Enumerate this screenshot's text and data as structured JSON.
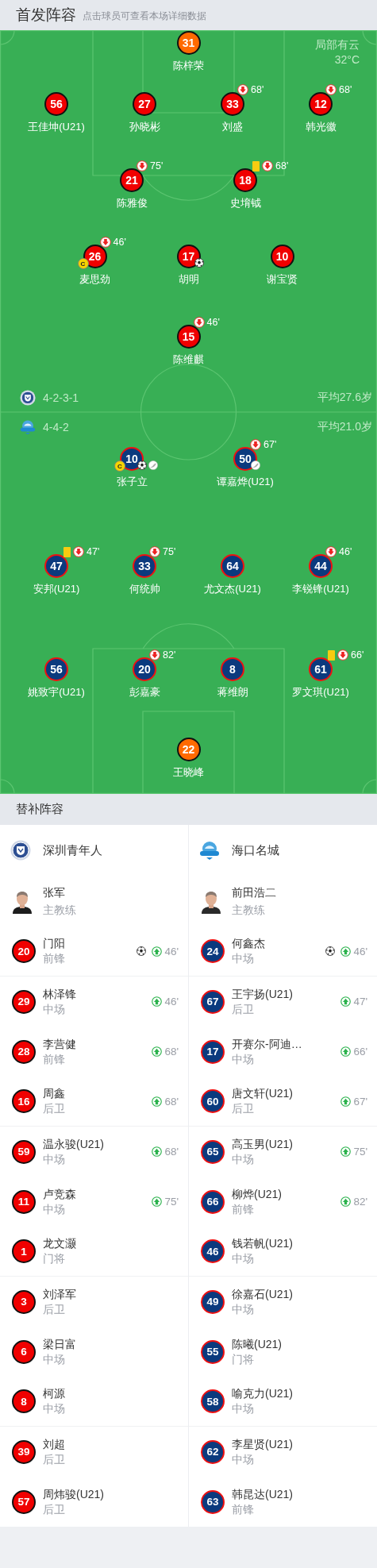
{
  "header": {
    "title": "首发阵容",
    "hint": "点击球员可查看本场详细数据"
  },
  "pitch": {
    "weather": "局部有云",
    "temperature": "32°C",
    "home": {
      "kind": "home",
      "formation": "4-2-3-1",
      "average_age": "平均27.6岁",
      "rows": [
        {
          "players": [
            {
              "number": "31",
              "name": "陈梓荣",
              "kind": "goalkeeper",
              "yellow_card": false,
              "goal": false,
              "assist": false
            }
          ]
        },
        {
          "players": [
            {
              "number": "56",
              "name": "王佳坤(U21)",
              "kind": "outfield",
              "yellow_card": false,
              "goal": false,
              "assist": false
            },
            {
              "number": "27",
              "name": "孙晓彬",
              "kind": "outfield",
              "yellow_card": false,
              "goal": false,
              "assist": false
            },
            {
              "number": "33",
              "name": "刘盛",
              "kind": "outfield",
              "yellow_card": false,
              "goal": false,
              "assist": false,
              "sub_out": "68'"
            },
            {
              "number": "12",
              "name": "韩光徽",
              "kind": "outfield",
              "yellow_card": false,
              "goal": false,
              "assist": false,
              "sub_out": "68'"
            }
          ]
        },
        {
          "players": [
            {
              "number": "21",
              "name": "陈雅俊",
              "kind": "outfield",
              "yellow_card": false,
              "goal": false,
              "assist": false,
              "sub_out": "75'"
            },
            {
              "number": "18",
              "name": "史堉钺",
              "kind": "outfield",
              "yellow_card": true,
              "goal": false,
              "assist": false,
              "sub_out": "68'"
            }
          ]
        },
        {
          "players": [
            {
              "number": "26",
              "name": "麦思劲",
              "kind": "outfield",
              "yellow_card": false,
              "goal": false,
              "assist": false,
              "sub_out": "46'",
              "captain_mark": "C"
            },
            {
              "number": "17",
              "name": "胡明",
              "kind": "outfield",
              "yellow_card": false,
              "goal": true,
              "assist": false
            },
            {
              "number": "10",
              "name": "谢宝贤",
              "kind": "outfield",
              "yellow_card": false,
              "goal": false,
              "assist": false
            }
          ]
        },
        {
          "players": [
            {
              "number": "15",
              "name": "陈维麒",
              "kind": "outfield",
              "yellow_card": false,
              "goal": false,
              "assist": false,
              "sub_out": "46'"
            }
          ]
        }
      ]
    },
    "away": {
      "kind": "away",
      "formation": "4-4-2",
      "average_age": "平均21.0岁",
      "rows": [
        {
          "players": [
            {
              "number": "10",
              "name": "张子立",
              "kind": "outfield",
              "yellow_card": false,
              "goal": true,
              "assist": true,
              "captain_mark": "C"
            },
            {
              "number": "50",
              "name": "谭嘉烨(U21)",
              "kind": "outfield",
              "yellow_card": false,
              "goal": false,
              "assist": true,
              "sub_out": "67'"
            }
          ]
        },
        {
          "players": [
            {
              "number": "47",
              "name": "安邦(U21)",
              "kind": "outfield",
              "yellow_card": true,
              "goal": false,
              "assist": false,
              "sub_out": "47'"
            },
            {
              "number": "33",
              "name": "何统帅",
              "kind": "outfield",
              "yellow_card": false,
              "goal": false,
              "assist": false,
              "sub_out": "75'"
            },
            {
              "number": "64",
              "name": "尤文杰(U21)",
              "kind": "outfield",
              "yellow_card": false,
              "goal": false,
              "assist": false
            },
            {
              "number": "44",
              "name": "李锐锋(U21)",
              "kind": "outfield",
              "yellow_card": false,
              "goal": false,
              "assist": false,
              "sub_out": "46'"
            }
          ]
        },
        {
          "players": [
            {
              "number": "56",
              "name": "姚致宇(U21)",
              "kind": "outfield",
              "yellow_card": false,
              "goal": false,
              "assist": false
            },
            {
              "number": "20",
              "name": "彭嘉豪",
              "kind": "outfield",
              "yellow_card": false,
              "goal": false,
              "assist": false,
              "sub_out": "82'"
            },
            {
              "number": "8",
              "name": "蒋维朗",
              "kind": "outfield",
              "yellow_card": false,
              "goal": false,
              "assist": false
            },
            {
              "number": "61",
              "name": "罗文琪(U21)",
              "kind": "outfield",
              "yellow_card": true,
              "goal": false,
              "assist": false,
              "sub_out": "66'"
            }
          ]
        },
        {
          "players": [
            {
              "number": "22",
              "name": "王晓峰",
              "kind": "goalkeeper",
              "yellow_card": false,
              "goal": false,
              "assist": false
            }
          ]
        }
      ]
    }
  },
  "substitutes": {
    "title": "替补阵容",
    "teams": [
      {
        "kind": "home",
        "name": "深圳青年人",
        "coach": {
          "name": "张军",
          "role": "主教练"
        },
        "players": [
          {
            "number": "20",
            "name": "门阳",
            "position": "前锋",
            "goal": true,
            "sub_in": "46'"
          },
          {
            "number": "29",
            "name": "林泽锋",
            "position": "中场",
            "goal": false,
            "sub_in": "46'"
          },
          {
            "number": "28",
            "name": "李营健",
            "position": "前锋",
            "goal": false,
            "sub_in": "68'"
          },
          {
            "number": "16",
            "name": "周鑫",
            "position": "后卫",
            "goal": false,
            "sub_in": "68'"
          },
          {
            "number": "59",
            "name": "温永骏(U21)",
            "position": "中场",
            "goal": false,
            "sub_in": "68'"
          },
          {
            "number": "11",
            "name": "卢竞森",
            "position": "中场",
            "goal": false,
            "sub_in": "75'"
          },
          {
            "number": "1",
            "name": "龙文灏",
            "position": "门将",
            "goal": false
          },
          {
            "number": "3",
            "name": "刘泽军",
            "position": "后卫",
            "goal": false
          },
          {
            "number": "6",
            "name": "梁日富",
            "position": "中场",
            "goal": false
          },
          {
            "number": "8",
            "name": "柯源",
            "position": "中场",
            "goal": false
          },
          {
            "number": "39",
            "name": "刘超",
            "position": "后卫",
            "goal": false
          },
          {
            "number": "57",
            "name": "周炜骏(U21)",
            "position": "后卫",
            "goal": false
          }
        ]
      },
      {
        "kind": "away",
        "name": "海口名城",
        "coach": {
          "name": "前田浩二",
          "role": "主教练"
        },
        "players": [
          {
            "number": "24",
            "name": "何鑫杰",
            "position": "中场",
            "goal": true,
            "sub_in": "46'"
          },
          {
            "number": "67",
            "name": "王宇扬(U21)",
            "position": "后卫",
            "goal": false,
            "sub_in": "47'"
          },
          {
            "number": "17",
            "name": "开赛尔-阿迪…",
            "position": "中场",
            "goal": false,
            "sub_in": "66'"
          },
          {
            "number": "60",
            "name": "唐文轩(U21)",
            "position": "后卫",
            "goal": false,
            "sub_in": "67'"
          },
          {
            "number": "65",
            "name": "高玉男(U21)",
            "position": "中场",
            "goal": false,
            "sub_in": "75'"
          },
          {
            "number": "66",
            "name": "柳烨(U21)",
            "position": "前锋",
            "goal": false,
            "sub_in": "82'"
          },
          {
            "number": "46",
            "name": "钱若帆(U21)",
            "position": "中场",
            "goal": false
          },
          {
            "number": "49",
            "name": "徐嘉石(U21)",
            "position": "中场",
            "goal": false
          },
          {
            "number": "55",
            "name": "陈曦(U21)",
            "position": "门将",
            "goal": false
          },
          {
            "number": "58",
            "name": "喻克力(U21)",
            "position": "中场",
            "goal": false
          },
          {
            "number": "62",
            "name": "李星贤(U21)",
            "position": "中场",
            "goal": false
          },
          {
            "number": "63",
            "name": "韩昆达(U21)",
            "position": "前锋",
            "goal": false
          }
        ]
      }
    ]
  }
}
